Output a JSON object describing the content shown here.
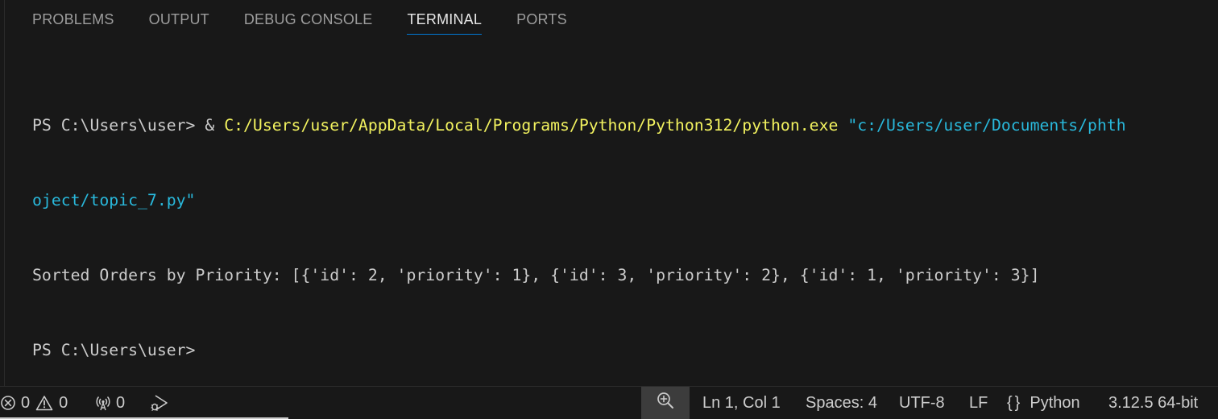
{
  "panel": {
    "tabs": [
      {
        "label": "PROBLEMS",
        "active": false
      },
      {
        "label": "OUTPUT",
        "active": false
      },
      {
        "label": "DEBUG CONSOLE",
        "active": false
      },
      {
        "label": "TERMINAL",
        "active": true
      },
      {
        "label": "PORTS",
        "active": false
      }
    ]
  },
  "terminal": {
    "line1_prompt": "PS C:\\Users\\user> & ",
    "line1_exe": "C:/Users/user/AppData/Local/Programs/Python/Python312/python.exe",
    "line1_arg": "\"c:/Users/user/Documents/phth",
    "line2_arg": "oject/topic_7.py\"",
    "line3_output": "Sorted Orders by Priority: [{'id': 2, 'priority': 1}, {'id': 3, 'priority': 2}, {'id': 1, 'priority': 3}]",
    "line4_prompt": "PS C:\\Users\\user>"
  },
  "statusbar": {
    "errors": "0",
    "warnings": "0",
    "ports": "0",
    "cursor_position": "Ln 1, Col 1",
    "indentation": "Spaces: 4",
    "encoding": "UTF-8",
    "eol": "LF",
    "language_braces": "{}",
    "language": "Python",
    "interpreter": "3.12.5 64-bit"
  },
  "icons": {
    "errors": "error-circle-icon",
    "warnings": "warning-triangle-icon",
    "ports": "broadcast-icon",
    "debug": "debug-run-icon",
    "zoom": "zoom-in-icon"
  },
  "colors": {
    "background": "#181818",
    "active_tab_underline": "#0078d4",
    "terminal_yellow": "#f2f25f",
    "terminal_cyan": "#29b8db"
  }
}
